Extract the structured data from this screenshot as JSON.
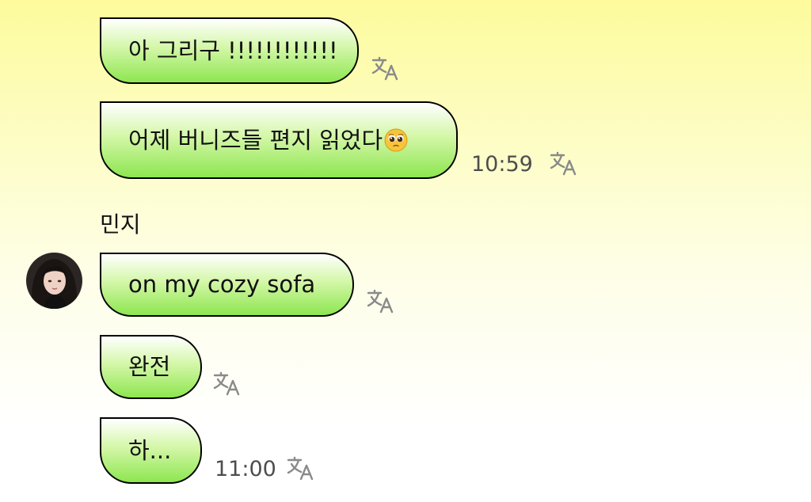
{
  "messages": [
    {
      "text": "아 그리구 !!!!!!!!!!!!"
    },
    {
      "text": "어제 버니즈들 편지 읽었다",
      "emoji": "pleading-face-emoji",
      "time": "10:59"
    },
    {
      "text": "on my cozy sofa"
    },
    {
      "text": "완전"
    },
    {
      "text": "하...",
      "time": "11:00"
    }
  ],
  "sender": {
    "name": "민지",
    "avatar": "profile-photo"
  },
  "icons": {
    "translate": "translate-icon"
  },
  "colors": {
    "bubble_top": "#ffffff",
    "bubble_bottom": "#8de650",
    "bubble_border": "#000000",
    "background_top": "#fdfb9c",
    "background_bottom": "#ffffff",
    "time_text": "#4d4d4d",
    "translate_icon": "#8a8a8a"
  }
}
